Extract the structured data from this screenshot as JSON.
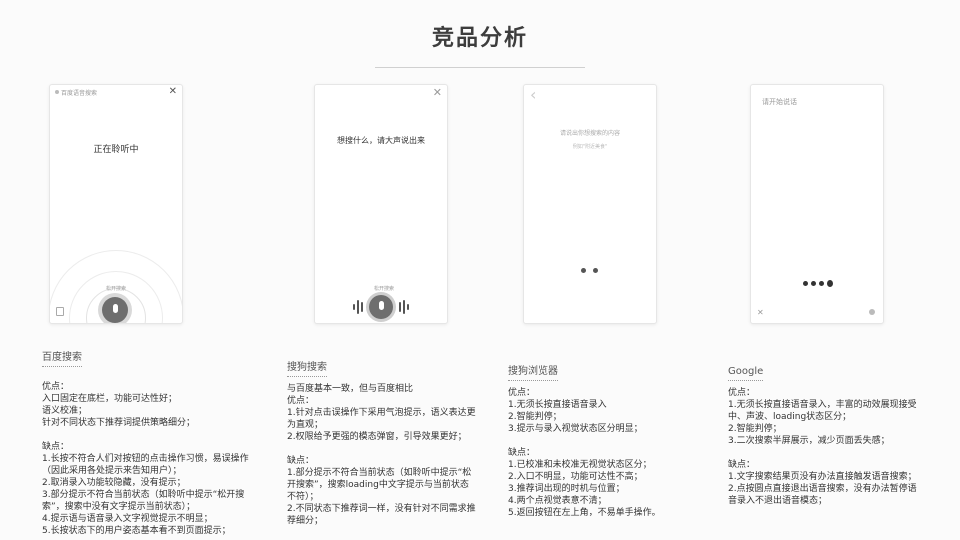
{
  "title": "竞品分析",
  "screens": {
    "baidu": {
      "header": "百度语音搜索",
      "status": "正在聆听中",
      "hint": "松开搜索",
      "close": "✕"
    },
    "sogou": {
      "status": "想搜什么，请大声说出来",
      "hint": "松开搜索",
      "close": "✕"
    },
    "sogou_browser": {
      "back": "‹",
      "prompt": "请说出你想搜索的内容",
      "example": "例如\"附近美食\""
    },
    "google": {
      "prompt": "请开始说话",
      "close": "✕"
    }
  },
  "analysis": [
    {
      "name": "百度搜索",
      "pros_label": "优点：",
      "pros": [
        "入口固定在底栏，功能可达性好；",
        "语义校准；",
        "针对不同状态下推荐词提供策略细分；"
      ],
      "cons_label": "缺点：",
      "cons": [
        "1.长按不符合人们对按钮的点击操作习惯，易误操作（因此采用各处提示来告知用户）；",
        "2.取消录入功能较隐藏，没有提示；",
        "3.部分提示不符合当前状态（如聆听中提示“松开搜索”，搜索中没有文字提示当前状态）；",
        "4.提示语与语音录入文字视觉提示不明显；",
        "5.长按状态下的用户姿态基本看不到页面提示；"
      ]
    },
    {
      "name": "搜狗搜索",
      "intro": "与百度基本一致，但与百度相比",
      "pros_label": "优点：",
      "pros": [
        "1.针对点击误操作下采用气泡提示，语义表达更为直观；",
        "2.权限给予更强的模态弹窗，引导效果更好；"
      ],
      "cons_label": "缺点：",
      "cons": [
        "1.部分提示不符合当前状态（如聆听中提示“松开搜索”，搜索loading中文字提示与当前状态不符）；",
        "2.不同状态下推荐词一样，没有针对不同需求推荐细分；"
      ]
    },
    {
      "name": "搜狗浏览器",
      "pros_label": "优点：",
      "pros": [
        "1.无须长按直接语音录入",
        "2.智能判停；",
        "3.提示与录入视觉状态区分明显；"
      ],
      "cons_label": "缺点：",
      "cons": [
        "1.已校准和未校准无视觉状态区分；",
        "2.入口不明显，功能可达性不高；",
        "3.推荐词出现的时机与位置；",
        "4.两个点视觉表意不清；",
        "5.返回按钮在左上角，不易单手操作。"
      ]
    },
    {
      "name": "Google",
      "pros_label": "优点：",
      "pros": [
        "1.无须长按直接语音录入，丰富的动效展现接受中、声波、loading状态区分；",
        "2.智能判停；",
        "3.二次搜索半屏展示，减少页面丢失感；"
      ],
      "cons_label": "缺点：",
      "cons": [
        "1.文字搜索结果页没有办法直接触发语音搜索；",
        "2.点按圆点直接退出语音搜索，没有办法暂停语音录入不退出语音模态；"
      ]
    }
  ]
}
